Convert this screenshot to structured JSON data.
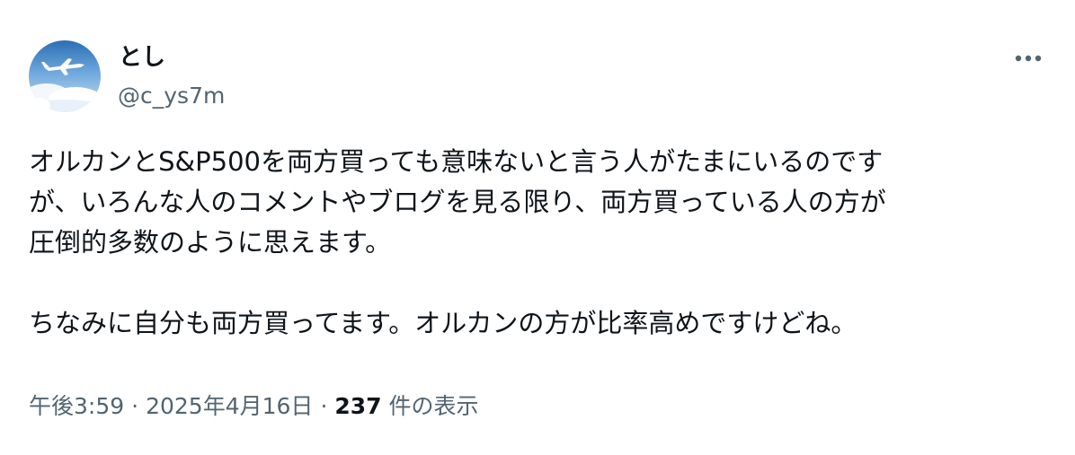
{
  "author": {
    "display_name": "とし",
    "handle": "@c_ys7m"
  },
  "tweet": {
    "lines": [
      "オルカンとS&P500を両方買っても意味ないと言う人がたまにいるのです",
      "が、いろんな人のコメントやブログを見る限り、両方買っている人の方が",
      "圧倒的多数のように思えます。",
      "ちなみに自分も両方買ってます。オルカンの方が比率高めですけどね。"
    ]
  },
  "meta": {
    "time": "午後3:59",
    "separator": "·",
    "date": "2025年4月16日",
    "views_count": "237",
    "views_label": "件の表示"
  },
  "icons": {
    "more": "more-horizontal-icon",
    "avatar": "airplane-over-clouds-avatar"
  },
  "colors": {
    "text_primary": "#0f1419",
    "text_secondary": "#536471"
  }
}
